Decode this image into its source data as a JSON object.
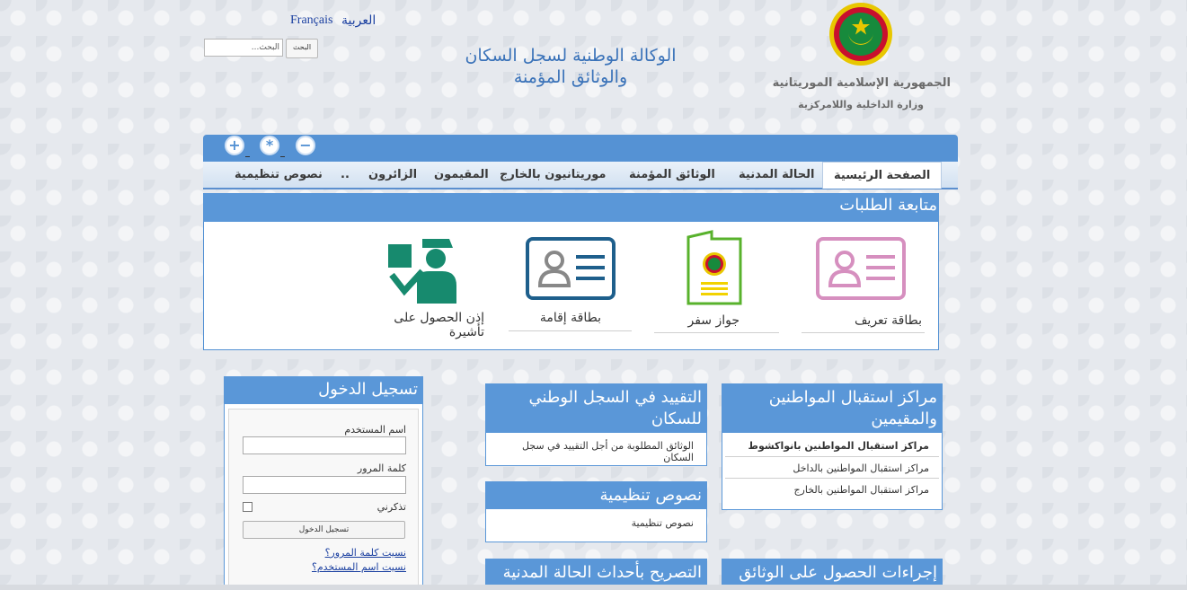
{
  "header": {
    "lang_fr": "Français",
    "lang_ar": "العربية",
    "search_placeholder": "البحث...",
    "search_button": "البحث",
    "agency_line1": "الوكالة الوطنية لسجل السكان",
    "agency_line2": "والوثائق المؤمنة",
    "republic": "الجمهورية الإسلامية الموريتانية",
    "ministry": "وزارة الداخلية واللامركزية"
  },
  "controls": {
    "zoom_in": "+",
    "reset": "*",
    "zoom_out": "−"
  },
  "nav": {
    "items": [
      "الصفحة الرئيسية",
      "الحالة المدنية",
      "الوثائق المؤمنة",
      "موريتانيون بالخارج",
      "المقيمون",
      "الزائرون",
      "..",
      "نصوص تنظيمية"
    ]
  },
  "tracking": {
    "title": "متابعة الطلبات",
    "services": [
      "بطاقة تعريف",
      "جواز سفر",
      "بطاقة إقامة",
      "إذن الحصول على تأشيرة"
    ]
  },
  "centers": {
    "title": "مراكز استقبال المواطنين والمقيمين",
    "links": [
      "مراكز استقبال المواطنين بانواكشوط",
      "مراكز استقبال المواطنين بالداخل",
      "مراكز استقبال المواطنين بالخارج"
    ]
  },
  "registration": {
    "title": "التقييد في السجل الوطني للسكان",
    "links": [
      "الوثائق المطلوبة من أجل التقييد في سجل السكان"
    ]
  },
  "regulations": {
    "title": "نصوص تنظيمية",
    "links": [
      "نصوص تنظيمية"
    ]
  },
  "procedures": {
    "title": "إجراءات الحصول على الوثائق"
  },
  "civil_events": {
    "title": "التصريح بأحداث الحالة المدنية"
  },
  "login": {
    "title": "تسجيل الدخول",
    "username_label": "اسم المستخدم",
    "password_label": "كلمة المرور",
    "remember_label": "تذكرني",
    "submit": "تسجيل الدخول",
    "forgot_password": "نسيت كلمة المرور؟",
    "forgot_username": "نسيت اسم المستخدم؟"
  },
  "colors": {
    "primary": "#5a97d8",
    "nav_text": "#3a3a3a",
    "agency": "#3b73b9"
  }
}
